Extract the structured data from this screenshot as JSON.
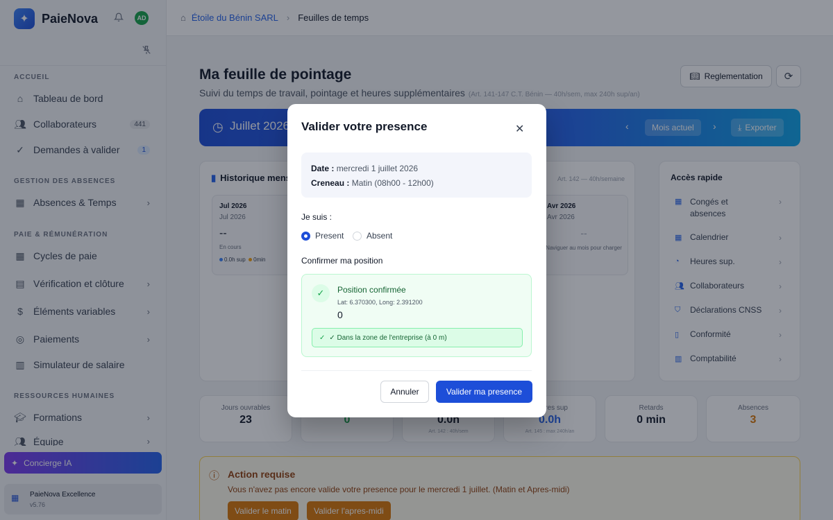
{
  "app": {
    "name": "PaieNova",
    "user_initials": "AD"
  },
  "breadcrumb": {
    "company": "Étoile du Bénin SARL",
    "page": "Feuilles de temps"
  },
  "sidebar": {
    "sections": [
      {
        "label": "ACCUEIL"
      },
      {
        "label": "GESTION DES ABSENCES"
      },
      {
        "label": "PAIE & RÉMUNÉRATION"
      },
      {
        "label": "RESSOURCES HUMAINES"
      }
    ],
    "items": [
      {
        "label": "Tableau de bord",
        "icon": "home-icon"
      },
      {
        "label": "Collaborateurs",
        "icon": "users-icon",
        "badge": "441"
      },
      {
        "label": "Demandes à valider",
        "icon": "check-circle-icon",
        "badge": "1"
      },
      {
        "label": "Absences & Temps",
        "icon": "calendar-icon"
      },
      {
        "label": "Cycles de paie",
        "icon": "calendar-cycle-icon"
      },
      {
        "label": "Vérification et clôture",
        "icon": "file-check-icon"
      },
      {
        "label": "Éléments variables",
        "icon": "dollar-icon"
      },
      {
        "label": "Paiements",
        "icon": "coin-icon"
      },
      {
        "label": "Simulateur de salaire",
        "icon": "calculator-icon"
      },
      {
        "label": "Formations",
        "icon": "graduation-icon"
      },
      {
        "label": "Équipe",
        "icon": "team-icon"
      }
    ],
    "concierge": "Concierge IA",
    "plan": {
      "name": "PaieNova Excellence",
      "version": "v5.76"
    }
  },
  "main": {
    "title": "Ma feuille de pointage",
    "subtitle": "Suivi du temps de travail, pointage et heures supplémentaires",
    "subtitle_ref": "(Art. 141-147 C.T. Bénin — 40h/sem, max 240h sup/an)",
    "reglementation": "Reglementation",
    "month_label": "Juillet 2026",
    "current_month": "Mois actuel",
    "export": "Exporter",
    "history": {
      "title": "Historique mensuel",
      "ref": "Art. 142 — 40h/semaine",
      "cards": [
        {
          "m1": "Jul 2026",
          "m2": "Jul 2026",
          "m3": "--",
          "m4": "En cours",
          "sup": "0.0h sup",
          "min": "0min"
        },
        {
          "m1": "Avr 2026",
          "m2": "Avr 2026",
          "m3": "--",
          "m4": "Naviguer au mois pour charger"
        }
      ]
    },
    "quick": {
      "title": "Accès rapide",
      "items": [
        {
          "label": "Congés et absences",
          "icon": "calendar-icon"
        },
        {
          "label": "Calendrier",
          "icon": "calendar-icon"
        },
        {
          "label": "Heures sup.",
          "icon": "timer-icon"
        },
        {
          "label": "Collaborateurs",
          "icon": "users-icon"
        },
        {
          "label": "Déclarations CNSS",
          "icon": "shield-icon"
        },
        {
          "label": "Conformité",
          "icon": "book-icon"
        },
        {
          "label": "Comptabilité",
          "icon": "calculator-icon"
        }
      ]
    },
    "stats": [
      {
        "label": "Jours ouvrables",
        "value": "23",
        "sub": ""
      },
      {
        "label": "",
        "value": "0",
        "sub": ""
      },
      {
        "label": "",
        "value": "0.0h",
        "sub": "Art. 142 : 40h/sem"
      },
      {
        "label": "res sup",
        "value": "0.0h",
        "sub": "Art. 145 : max 240h/an"
      },
      {
        "label": "Retards",
        "value": "0 min",
        "sub": ""
      },
      {
        "label": "Absences",
        "value": "3",
        "sub": ""
      }
    ],
    "action": {
      "title": "Action requise",
      "text": "Vous n'avez pas encore valide votre presence pour le mercredi 1 juillet. (Matin et Apres-midi)",
      "btn_morning": "Valider le matin",
      "btn_afternoon": "Valider l'apres-midi"
    }
  },
  "modal": {
    "title": "Valider votre presence",
    "date_label": "Date :",
    "date_value": "mercredi 1 juillet 2026",
    "slot_label": "Creneau :",
    "slot_value": "Matin (08h00 - 12h00)",
    "je_suis": "Je suis :",
    "present": "Present",
    "absent": "Absent",
    "selected": "Present",
    "confirm_label": "Confirmer ma position",
    "position_title": "Position confirmée",
    "coords": "Lat: 6.370300, Long: 2.391200",
    "distance": "0",
    "zone": "✓ Dans la zone de l'entreprise (à 0 m)",
    "cancel": "Annuler",
    "validate": "Valider ma presence"
  },
  "colors": {
    "accent": "#1d4ed8",
    "success": "#16a34a",
    "warning": "#d97706"
  }
}
